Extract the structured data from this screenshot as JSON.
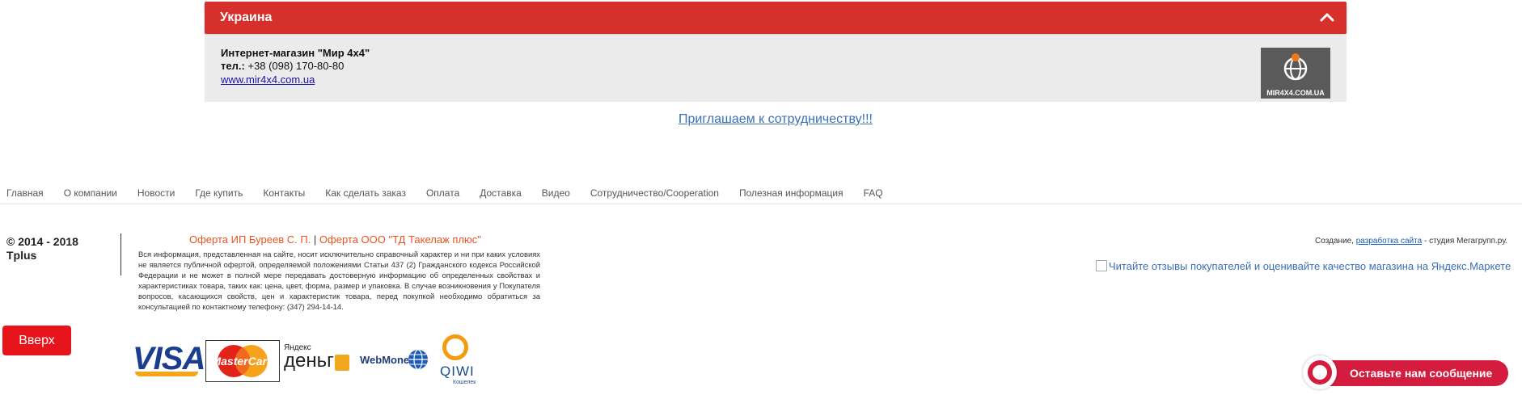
{
  "region": {
    "title": "Украина",
    "dealer": {
      "name": "Интернет-магазин \"Мир 4x4\"",
      "tel_label": "тел.:",
      "tel_value": " +38 (098) 170-80-80",
      "site": "www.mir4x4.com.ua",
      "logo_text": "MIR4X4.COM.UA"
    }
  },
  "invite_link": "Приглашаем к сотрудничеству!!!",
  "nav": [
    "Главная",
    "О компании",
    "Новости",
    "Где купить",
    "Контакты",
    "Как сделать заказ",
    "Оплата",
    "Доставка",
    "Видео",
    "Сотрудничество/Cooperation",
    "Полезная информация",
    "FAQ"
  ],
  "footer": {
    "copyright_line1": "© 2014 - 2018",
    "copyright_line2": "Tplus",
    "oferta1": "Оферта ИП Буреев С. П.",
    "oferta_sep": " | ",
    "oferta2": "Оферта ООО \"ТД Такелаж плюс\"",
    "disclaimer": "Вся информация, представленная на сайте, носит исключительно справочный характер и ни при каких условиях не является публичной офертой, определяемой положениями Статьи 437 (2) Гражданского кодекса Российской Федерации и не может в полной мере передавать достоверную информацию об определенных свойствах и характеристиках товара, таких как: цена, цвет, форма, размер и упаковка. В случае возникновения у Покупателя вопросов, касающихся свойств, цен и характеристик товара, перед покупкой необходимо обратиться за консультацией по контактному телефону: (347) 294-14-14.",
    "credit_prefix": "Создание, ",
    "credit_link": "разработка сайта",
    "credit_suffix": " - студия Мегагрупп.ру.",
    "yandex_alt": "Читайте отзывы покупателей и оценивайте качество магазина на Яндекс.Маркете",
    "up_button": "Вверх"
  },
  "payments": {
    "visa": "VISA",
    "mastercard": "MasterCard",
    "ydengi_small": "Яндекс",
    "ydengi_big": "деньги",
    "webmoney": "WebMoney",
    "qiwi": "QIWI",
    "qiwi_small": "Кошелек"
  },
  "chat": {
    "label": "Оставьте нам сообщение"
  },
  "colors": {
    "accent_red": "#d6302d",
    "chat_red": "#d41c3f",
    "link_blue": "#3a6fb5",
    "oferta_orange": "#e8541e"
  }
}
